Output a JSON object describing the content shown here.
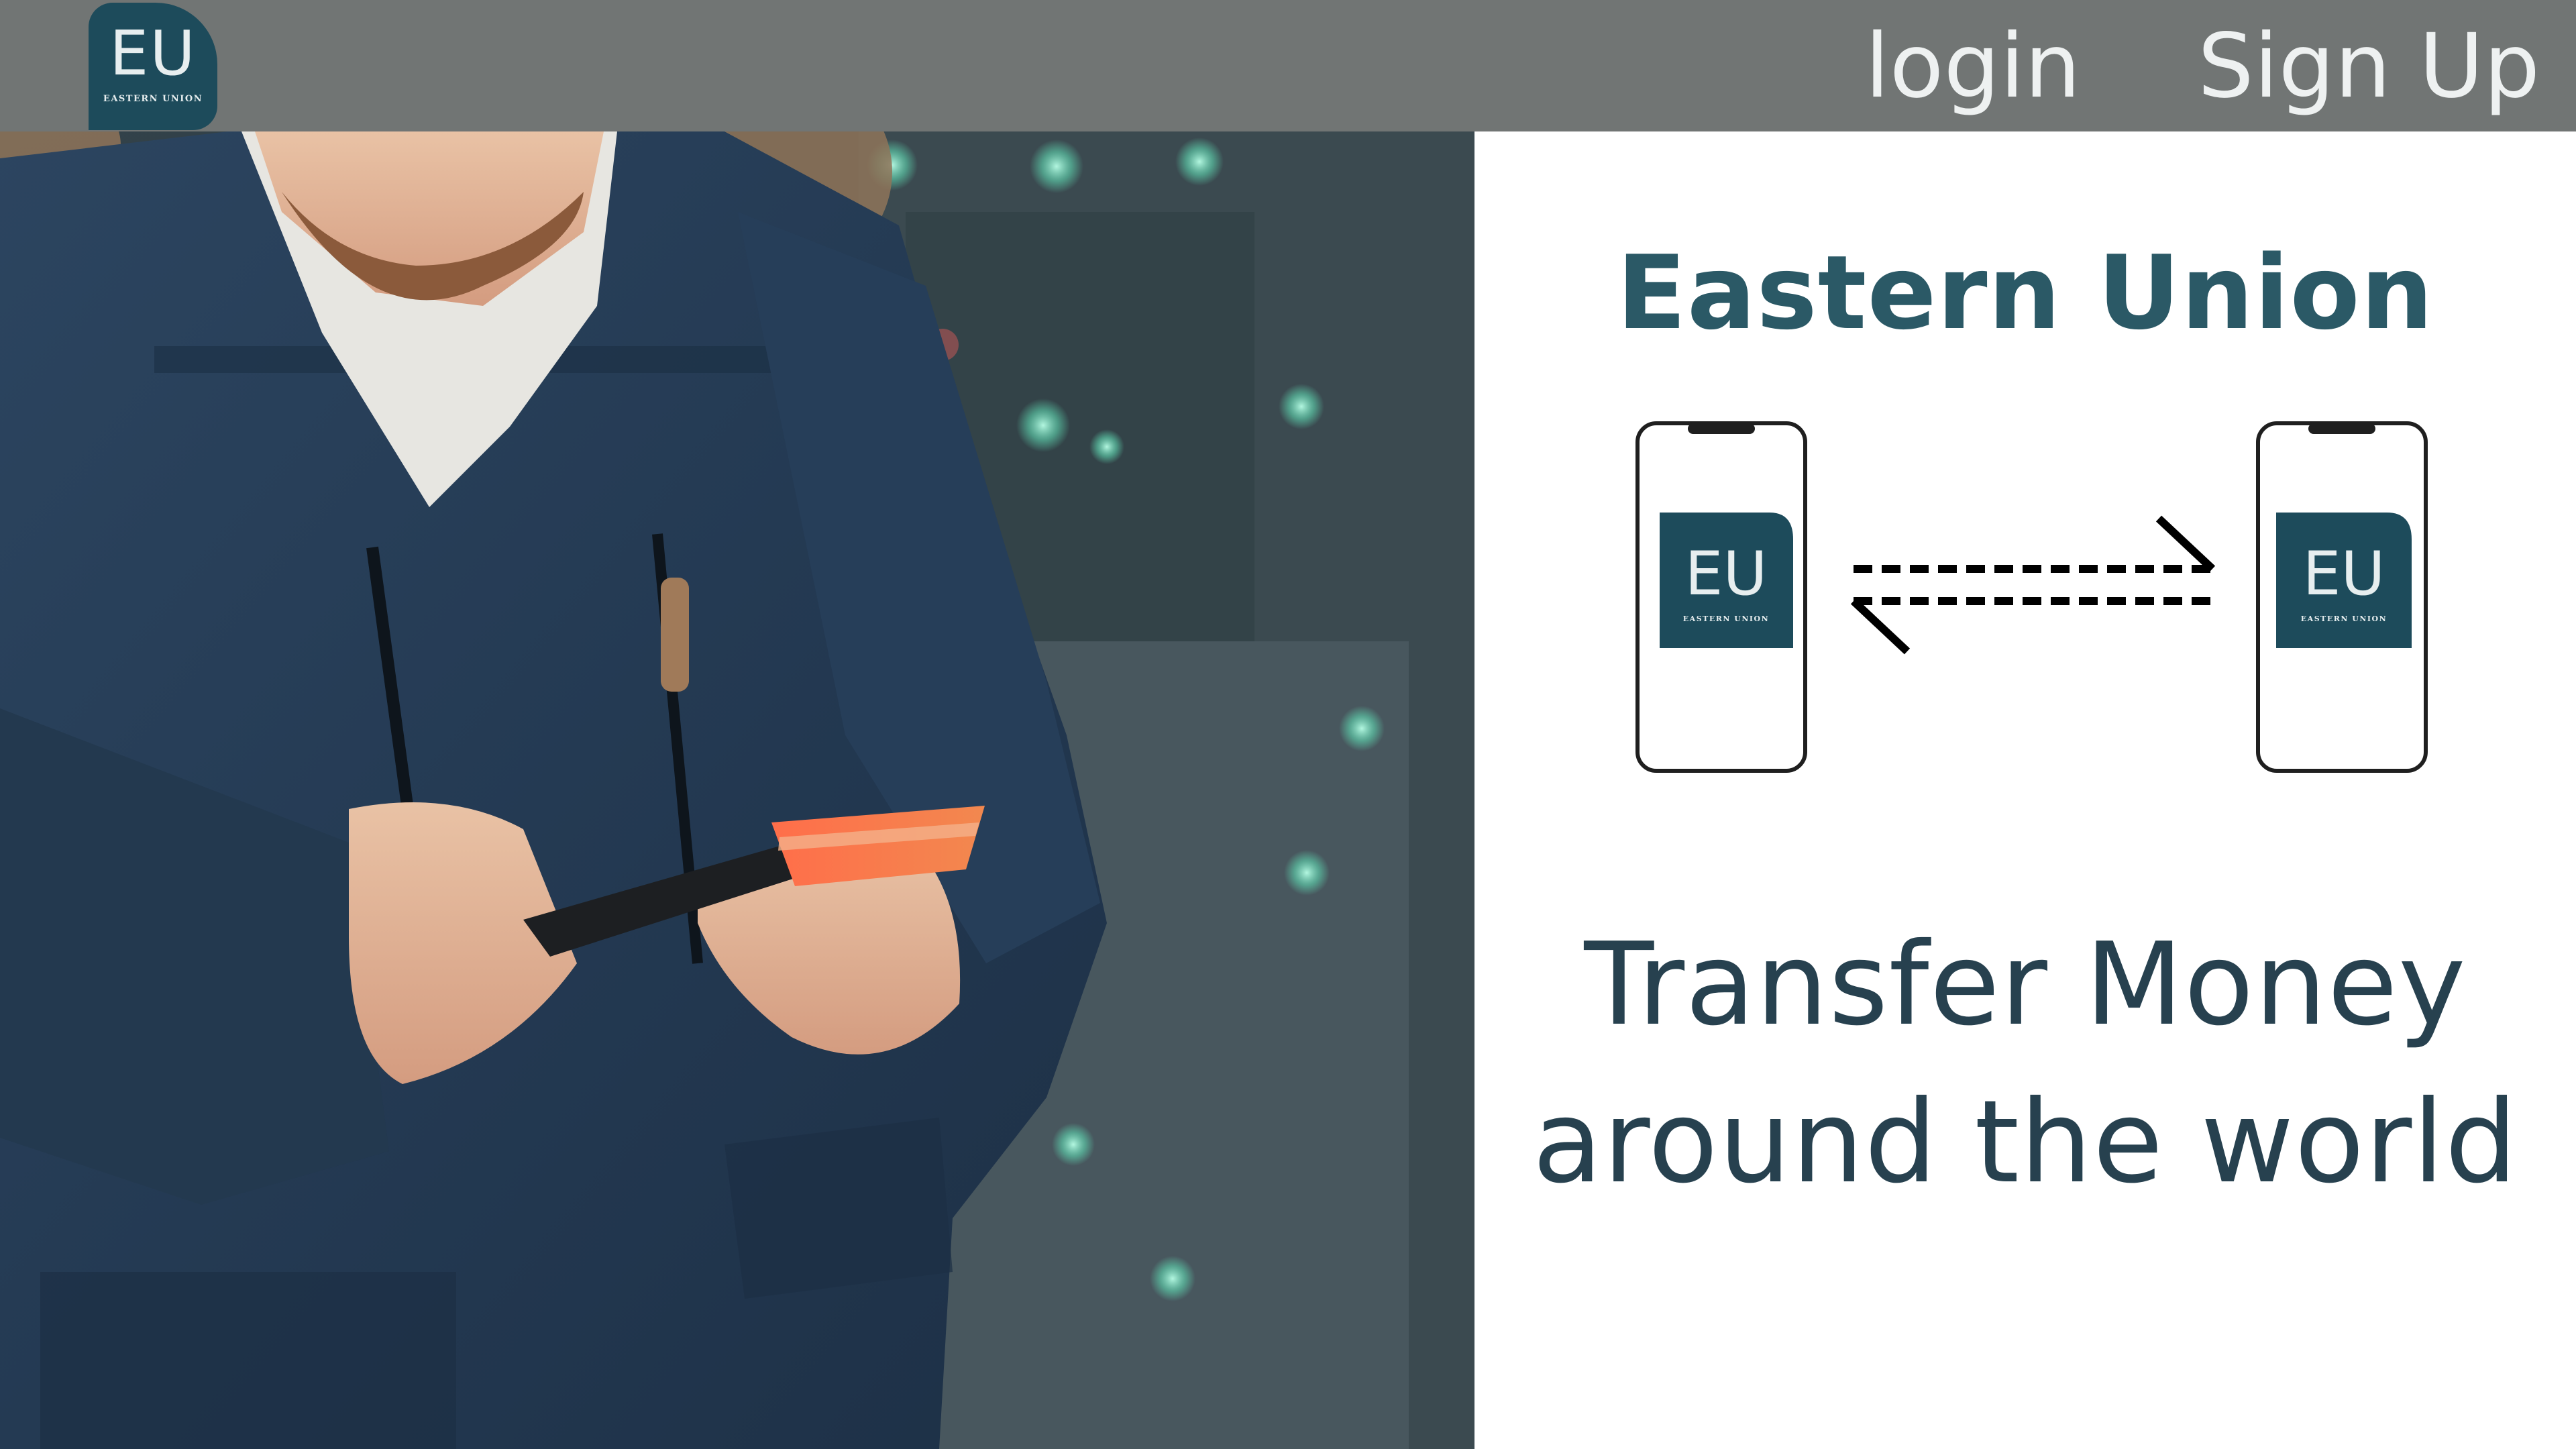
{
  "header": {
    "logo": {
      "mark": "EU",
      "caption": "EASTERN UNION"
    },
    "nav": {
      "login_label": "login",
      "signup_label": "Sign Up"
    }
  },
  "hero": {
    "alt": "Man in a blue winter jacket holding a phone and an orange credit card"
  },
  "panel": {
    "brand_title": "Eastern Union",
    "transfer_diagram": {
      "left_phone_logo": "EU",
      "left_phone_caption": "EASTERN UNION",
      "right_phone_logo": "EU",
      "right_phone_caption": "EASTERN UNION"
    },
    "tagline_line1": "Transfer Money",
    "tagline_line2": "around the world"
  },
  "colors": {
    "topbar": "#717574",
    "brand_teal": "#1d4b5b",
    "title_teal": "#2b5966",
    "tagline": "#27414f",
    "nav_text": "#eef1f1"
  },
  "icons": [
    "logo-badge",
    "phone-outline-icon",
    "dashed-transfer-arrows-icon"
  ]
}
